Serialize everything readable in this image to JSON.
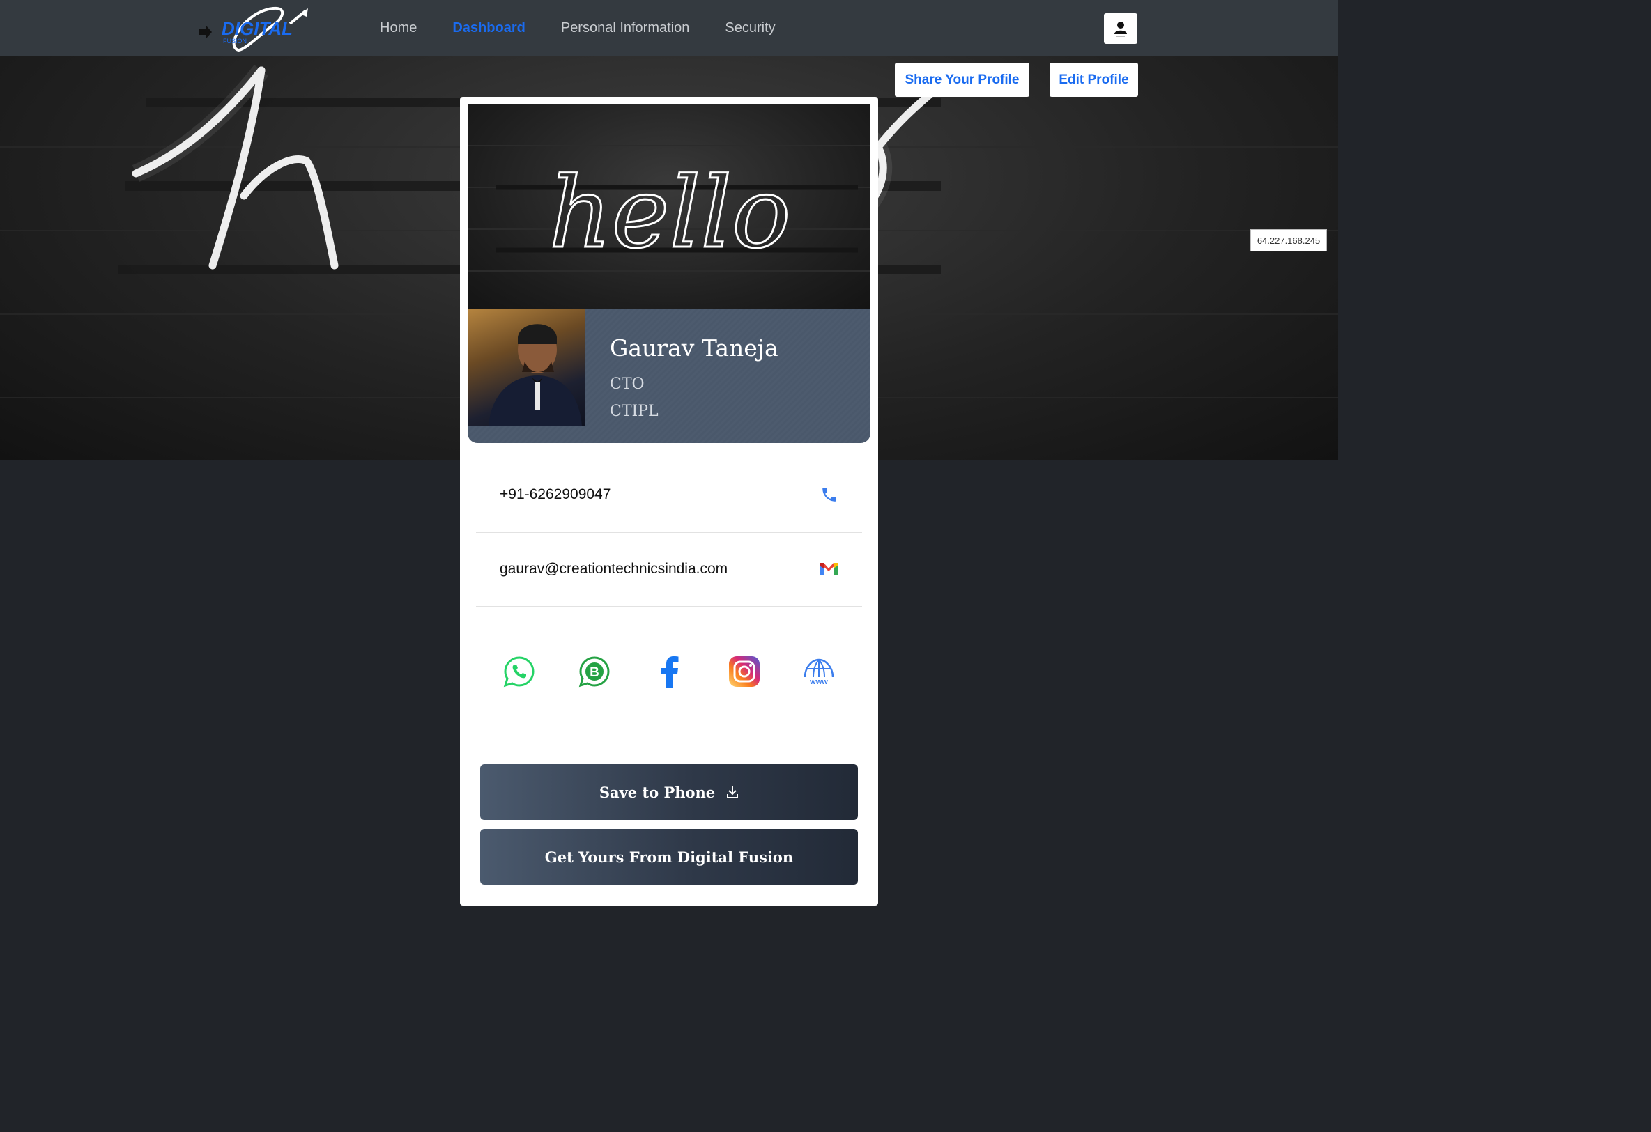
{
  "nav": {
    "logo_text": "DIGITAL",
    "logo_subtext": "FUSION",
    "links": [
      {
        "label": "Home",
        "active": false
      },
      {
        "label": "Dashboard",
        "active": true
      },
      {
        "label": "Personal Information",
        "active": false
      },
      {
        "label": "Security",
        "active": false
      }
    ]
  },
  "hero": {
    "share_label": "Share Your Profile",
    "edit_label": "Edit Profile",
    "ip_text": "64.227.168.245"
  },
  "card": {
    "cover_text": "hello",
    "name": "Gaurav Taneja",
    "title": "CTO",
    "company": "CTIPL",
    "phone": "+91-6262909047",
    "email": "gaurav@creationtechnicsindia.com",
    "socials": [
      "whatsapp-icon",
      "whatsapp-business-icon",
      "facebook-icon",
      "instagram-icon",
      "website-icon"
    ],
    "save_label": "Save to Phone",
    "get_label": "Get Yours From Digital Fusion"
  },
  "colors": {
    "accent": "#1a6bf0",
    "navbar": "#343a40",
    "page_bg": "#212429"
  }
}
